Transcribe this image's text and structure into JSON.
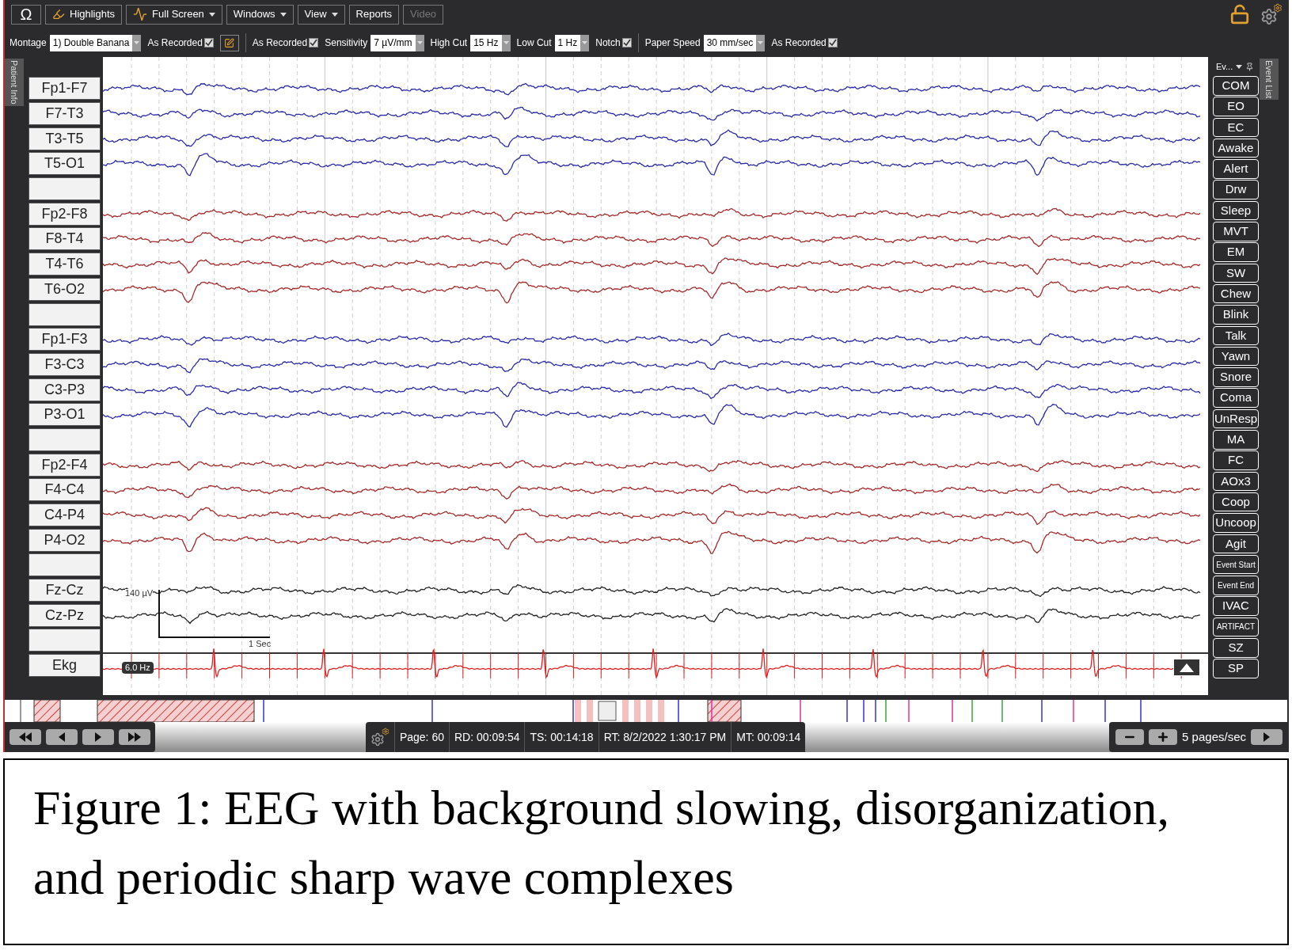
{
  "toolbar": {
    "buttons": [
      {
        "label": "Ω",
        "kind": "omega",
        "disabled": false
      },
      {
        "label": "Highlights",
        "kind": "highlighter",
        "disabled": false
      },
      {
        "label": "Full Screen",
        "kind": "wave_menu",
        "disabled": false
      },
      {
        "label": "Windows",
        "kind": "menu",
        "disabled": false
      },
      {
        "label": "View",
        "kind": "menu",
        "disabled": false
      },
      {
        "label": "Reports",
        "kind": "plain",
        "disabled": false
      },
      {
        "label": "Video",
        "kind": "plain",
        "disabled": true
      }
    ]
  },
  "settings": [
    {
      "kind": "select",
      "label": "Montage",
      "value": "1) Double Banana"
    },
    {
      "kind": "check",
      "label": "As Recorded",
      "checked": true
    },
    {
      "kind": "edit"
    },
    {
      "kind": "divider"
    },
    {
      "kind": "check",
      "label": "As Recorded",
      "checked": true
    },
    {
      "kind": "select",
      "label": "Sensitivity",
      "value": "7 µV/mm"
    },
    {
      "kind": "select",
      "label": "High Cut",
      "value": "15 Hz"
    },
    {
      "kind": "select",
      "label": "Low Cut",
      "value": "1 Hz"
    },
    {
      "kind": "check",
      "label": "Notch",
      "checked": true
    },
    {
      "kind": "divider"
    },
    {
      "kind": "select",
      "label": "Paper Speed",
      "value": "30 mm/sec"
    },
    {
      "kind": "check",
      "label": "As Recorded",
      "checked": true
    }
  ],
  "side_tabs": {
    "left": "Patient Info",
    "right": "Event List"
  },
  "channels": [
    {
      "kind": "trace",
      "label": "Fp1-F7",
      "color": "#2b2ba8"
    },
    {
      "kind": "trace",
      "label": "F7-T3",
      "color": "#2b2ba8"
    },
    {
      "kind": "trace",
      "label": "T3-T5",
      "color": "#2b2ba8"
    },
    {
      "kind": "trace",
      "label": "T5-O1",
      "color": "#2b2ba8"
    },
    {
      "kind": "blank"
    },
    {
      "kind": "trace",
      "label": "Fp2-F8",
      "color": "#a52a2a"
    },
    {
      "kind": "trace",
      "label": "F8-T4",
      "color": "#a52a2a"
    },
    {
      "kind": "trace",
      "label": "T4-T6",
      "color": "#a52a2a"
    },
    {
      "kind": "trace",
      "label": "T6-O2",
      "color": "#a52a2a"
    },
    {
      "kind": "blank"
    },
    {
      "kind": "trace",
      "label": "Fp1-F3",
      "color": "#2b2ba8"
    },
    {
      "kind": "trace",
      "label": "F3-C3",
      "color": "#2b2ba8"
    },
    {
      "kind": "trace",
      "label": "C3-P3",
      "color": "#2b2ba8"
    },
    {
      "kind": "trace",
      "label": "P3-O1",
      "color": "#2b2ba8"
    },
    {
      "kind": "blank"
    },
    {
      "kind": "trace",
      "label": "Fp2-F4",
      "color": "#a52a2a"
    },
    {
      "kind": "trace",
      "label": "F4-C4",
      "color": "#a52a2a"
    },
    {
      "kind": "trace",
      "label": "C4-P4",
      "color": "#a52a2a"
    },
    {
      "kind": "trace",
      "label": "P4-O2",
      "color": "#a52a2a"
    },
    {
      "kind": "blank"
    },
    {
      "kind": "trace",
      "label": "Fz-Cz",
      "color": "#222222"
    },
    {
      "kind": "trace",
      "label": "Cz-Pz",
      "color": "#222222"
    },
    {
      "kind": "blank"
    },
    {
      "kind": "ekg",
      "label": "Ekg",
      "color": "#e02020"
    }
  ],
  "scale": {
    "amplitude": "140 µV",
    "time": "1 Sec"
  },
  "ekg_filter": "6.0 Hz",
  "events": {
    "header": "Ev...",
    "buttons": [
      "COM",
      "EO",
      "EC",
      "Awake",
      "Alert",
      "Drw",
      "Sleep",
      "MVT",
      "EM",
      "SW",
      "Chew",
      "Blink",
      "Talk",
      "Yawn",
      "Snore",
      "Coma",
      "UnResp",
      "MA",
      "FC",
      "AOx3",
      "Coop",
      "Uncoop",
      "Agit",
      "Event Start",
      "Event End",
      "IVAC",
      "ARTIFACT",
      "SZ",
      "SP"
    ]
  },
  "status": {
    "fields": [
      "Page: 60",
      "RD: 00:09:54",
      "TS: 00:14:18",
      "RT: 8/2/2022 1:30:17 PM",
      "MT: 00:09:14"
    ],
    "speed": "5 pages/sec"
  },
  "caption": "Figure 1: EEG with background slowing, disorganization, and periodic sharp wave complexes"
}
